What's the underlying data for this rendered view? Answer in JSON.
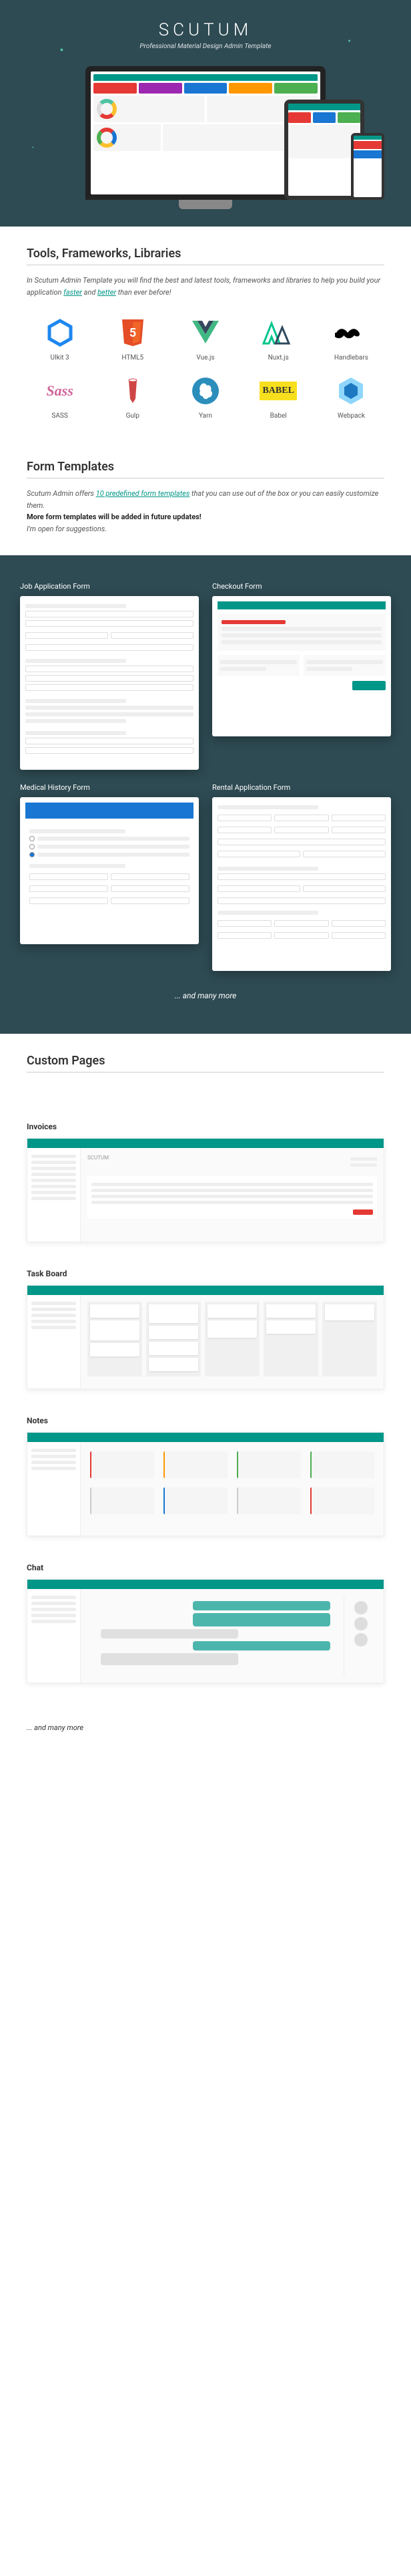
{
  "hero": {
    "title": "SCUTUM",
    "subtitle": "Professional Material Design Admin Template"
  },
  "tools": {
    "heading": "Tools, Frameworks, Libraries",
    "intro_pre": "In Scutum Admin Template you will find the best and latest tools, frameworks and libraries to help you build your application ",
    "hl1": "faster",
    "mid": " and ",
    "hl2": "better",
    "intro_post": " than ever before!",
    "items": [
      {
        "label": "UIkit 3"
      },
      {
        "label": "HTML5"
      },
      {
        "label": "Vue.js"
      },
      {
        "label": "Nuxt.js"
      },
      {
        "label": "Handlebars"
      },
      {
        "label": "SASS"
      },
      {
        "label": "Gulp"
      },
      {
        "label": "Yarn"
      },
      {
        "label": "Babel"
      },
      {
        "label": "Webpack"
      }
    ]
  },
  "forms": {
    "heading": "Form Templates",
    "intro_1": "Scutum Admin offers ",
    "intro_link": "10 predefined form templates",
    "intro_2": " that you can use out of the box or you can easily customize them.",
    "intro_bold": "More form templates will be added in future updates!",
    "intro_3": "I'm open for suggestions.",
    "items": [
      "Job Application Form",
      "Checkout Form",
      "Medical History Form",
      "Rental Application Form"
    ],
    "more": "... and many more"
  },
  "custom": {
    "heading": "Custom Pages",
    "items": [
      "Invoices",
      "Task Board",
      "Notes",
      "Chat"
    ],
    "more": "... and many more"
  },
  "colors": {
    "teal": "#009688",
    "dark": "#2e4a52",
    "orange": "#ff9800",
    "red": "#e53935",
    "blue": "#1976d2",
    "green": "#4caf50",
    "purple": "#9c27b0",
    "pink": "#cf649a",
    "yellow": "#f7df1e"
  }
}
